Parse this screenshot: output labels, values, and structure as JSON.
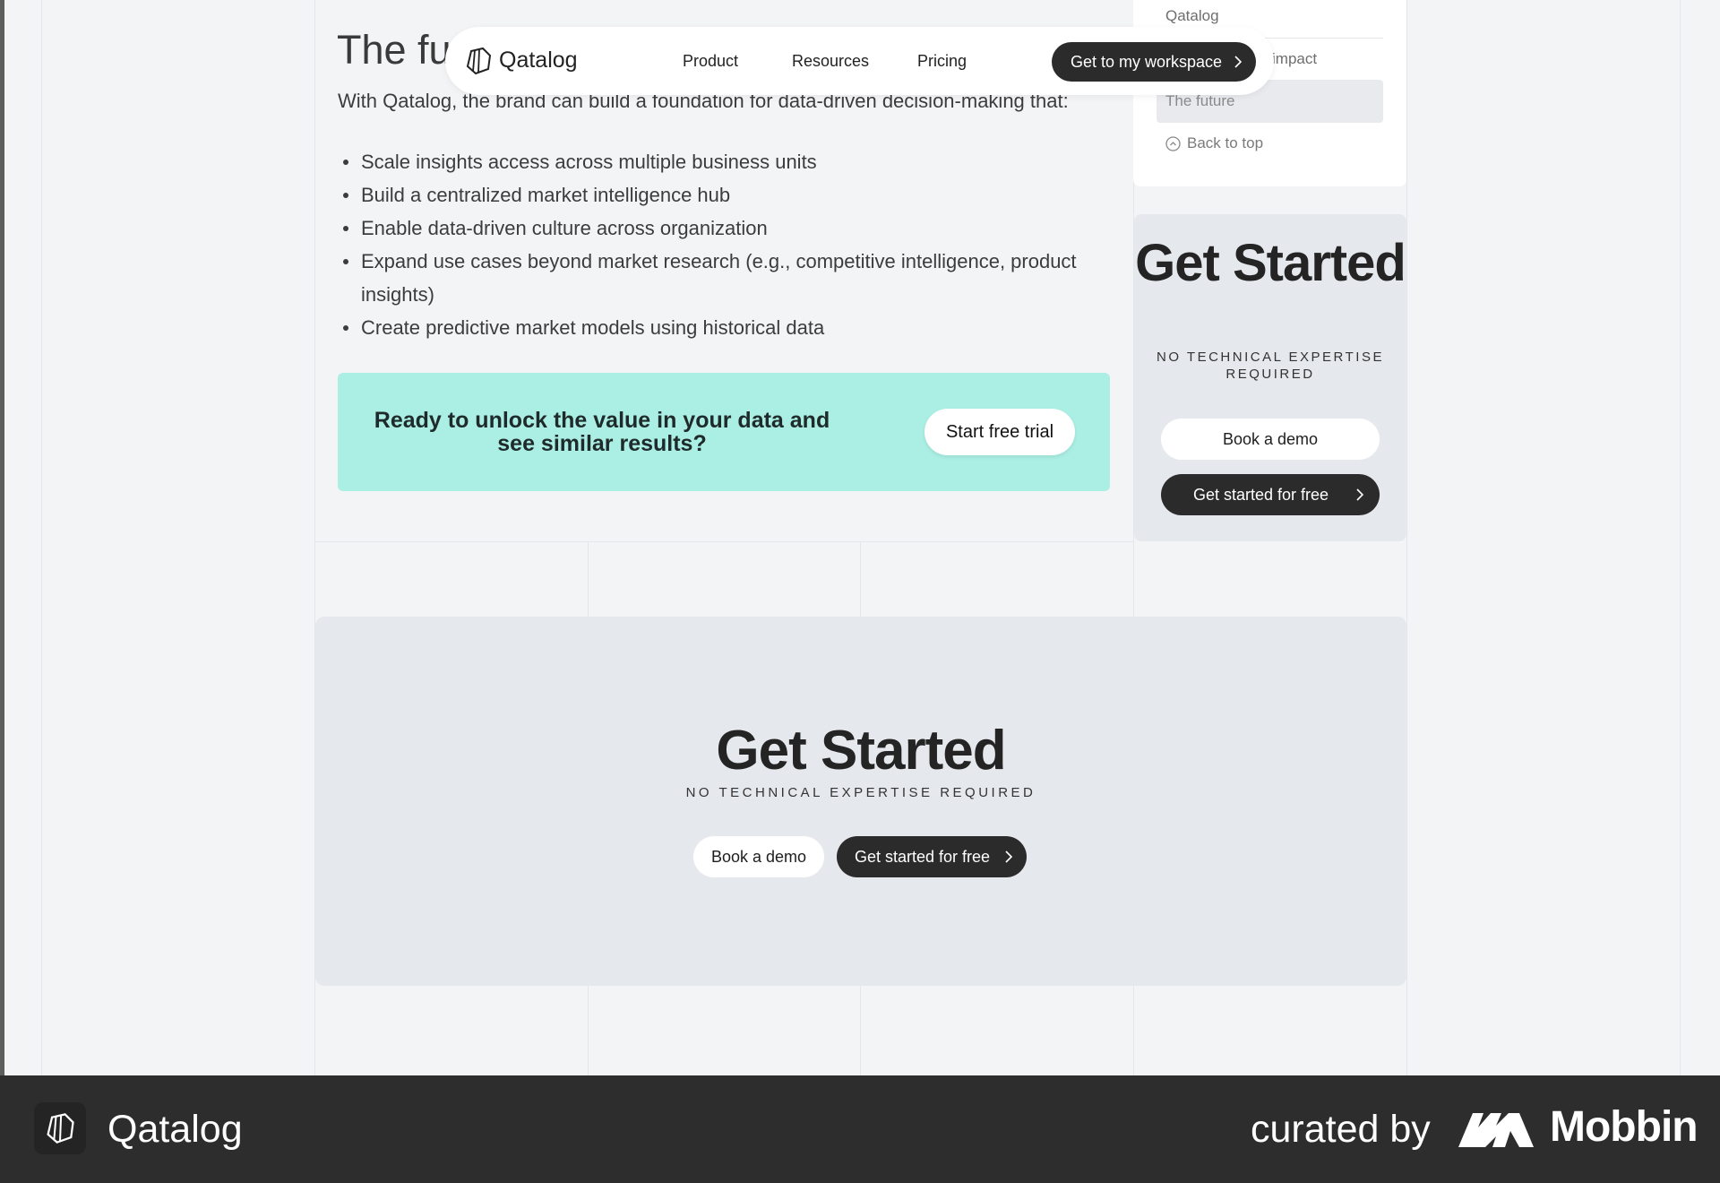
{
  "article": {
    "heading": "The fu",
    "intro": "With Qatalog, the brand can build a foundation for data-driven decision-making that:",
    "bullets": [
      "Scale insights access across multiple business units",
      "Build a centralized market intelligence hub",
      "Enable data-driven culture across organization",
      "Expand use cases beyond market research (e.g., competitive intelligence, product insights)",
      "Create predictive market models using historical data"
    ],
    "cta": {
      "text": "Ready to unlock the value in your data and see similar results?",
      "button": "Start free trial"
    }
  },
  "nav": {
    "brand": "Qatalog",
    "links": [
      "Product",
      "Resources",
      "Pricing"
    ],
    "cta": "Get to my workspace"
  },
  "toc": {
    "items": [
      "Qatalog",
      "impact",
      "The future"
    ],
    "active_index": 2,
    "back_to_top": "Back to top"
  },
  "side_card": {
    "title": "Get Started",
    "subtitle": "NO TECHNICAL EXPERTISE REQUIRED",
    "demo_button": "Book a demo",
    "free_button": "Get started for free"
  },
  "bottom_card": {
    "title": "Get Started",
    "subtitle": "NO TECHNICAL EXPERTISE REQUIRED",
    "demo_button": "Book a demo",
    "free_button": "Get started for free"
  },
  "footer": {
    "brand": "Qatalog",
    "curated_by": "curated by",
    "curator": "Mobbin"
  },
  "colors": {
    "accent_mint": "#aaeee4",
    "dark_button": "#2b2b2b",
    "footer_bg": "#2d2d2d"
  }
}
